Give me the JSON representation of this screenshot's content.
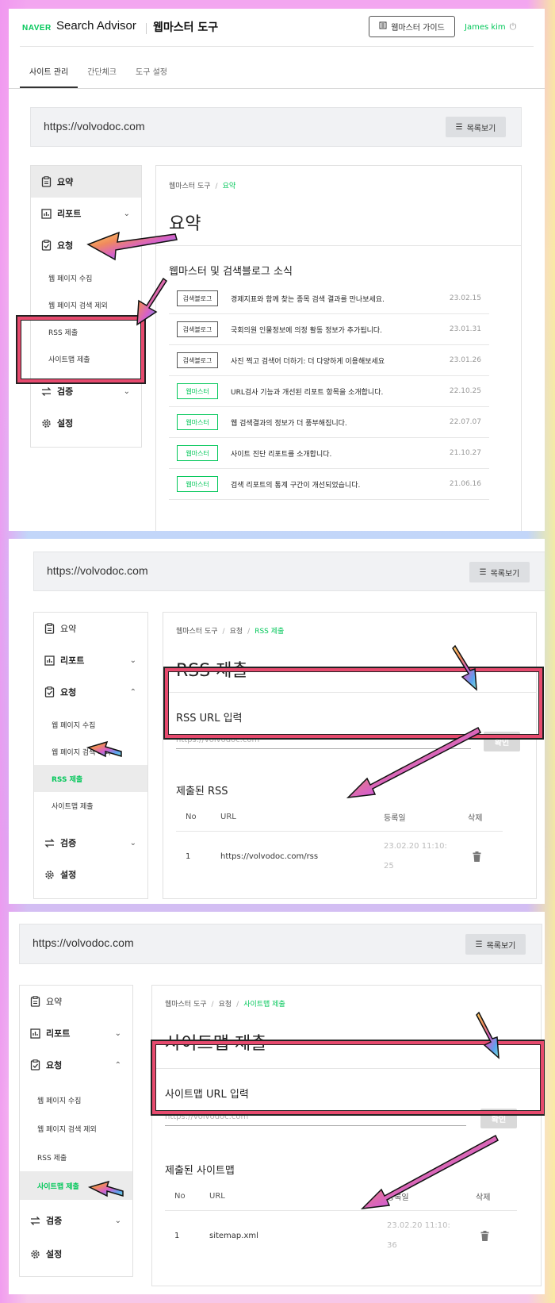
{
  "header": {
    "brand": "NAVER",
    "product": "Search Advisor",
    "tool": "웹마스터 도구",
    "guide_button": "웹마스터 가이드",
    "user": "James kim",
    "tabs": [
      "사이트 관리",
      "간단체크",
      "도구 설정"
    ]
  },
  "site": {
    "url": "https://volvodoc.com",
    "list_button": "목록보기"
  },
  "nav": {
    "summary": "요약",
    "report": "리포트",
    "request": "요청",
    "sub": [
      "웹 페이지 수집",
      "웹 페이지 검색 제외",
      "RSS 제출",
      "사이트맵 제출"
    ],
    "verify": "검증",
    "settings": "설정"
  },
  "summary_page": {
    "crumb_root": "웹마스터 도구",
    "crumb_current": "요약",
    "title": "요약",
    "news_title": "웹마스터 및 검색블로그 소식",
    "news": [
      {
        "badge": "검색블로그",
        "title": "경제지표와 함께 찾는 종목 검색 결과를 만나보세요.",
        "date": "23.02.15"
      },
      {
        "badge": "검색블로그",
        "title": "국회의원 인물정보에 의정 활동 정보가 추가됩니다.",
        "date": "23.01.31"
      },
      {
        "badge": "검색블로그",
        "title": "사진 찍고 검색어 더하기: 더 다양하게 이용해보세요",
        "date": "23.01.26"
      },
      {
        "badge": "웹마스터",
        "title": "URL검사 기능과 개선된 리포트 항목을 소개합니다.",
        "date": "22.10.25"
      },
      {
        "badge": "웹마스터",
        "title": "웹 검색결과의 정보가 더 풍부해집니다.",
        "date": "22.07.07"
      },
      {
        "badge": "웹마스터",
        "title": "사이트 진단 리포트를 소개합니다.",
        "date": "21.10.27"
      },
      {
        "badge": "웹마스터",
        "title": "검색 리포트의 통계 구간이 개선되었습니다.",
        "date": "21.06.16"
      }
    ]
  },
  "rss_page": {
    "crumb": [
      "웹마스터 도구",
      "요청",
      "RSS 제출"
    ],
    "title": "RSS 제출",
    "input_label": "RSS URL 입력",
    "placeholder": "https://volvodoc.com",
    "confirm": "확인",
    "submitted_title": "제출된 RSS",
    "columns": [
      "No",
      "URL",
      "등록일",
      "삭제"
    ],
    "row": {
      "no": "1",
      "url": "https://volvodoc.com/rss",
      "date1": "23.02.20 11:10:",
      "date2": "25"
    }
  },
  "sitemap_page": {
    "crumb": [
      "웹마스터 도구",
      "요청",
      "사이트맵 제출"
    ],
    "title": "사이트맵 제출",
    "input_label": "사이트맵 URL 입력",
    "placeholder": "https://volvodoc.com",
    "confirm": "확인",
    "submitted_title": "제출된 사이트맵",
    "columns": [
      "No",
      "URL",
      "등록일",
      "삭제"
    ],
    "row": {
      "no": "1",
      "url": "sitemap.xml",
      "date1": "23.02.20 11:10:",
      "date2": "36"
    }
  },
  "colors": {
    "accent": "#03c75a",
    "frame": "#e64a6e"
  },
  "icons": [
    "clipboard-icon",
    "bar-chart-icon",
    "checklist-icon",
    "swap-icon",
    "gear-icon",
    "trash-icon",
    "list-icon",
    "book-icon",
    "power-icon"
  ]
}
